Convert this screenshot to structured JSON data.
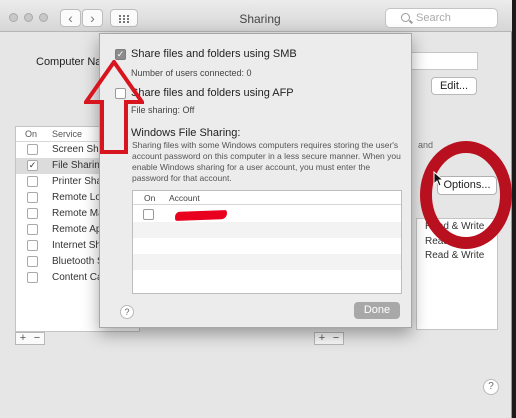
{
  "window": {
    "title": "Sharing",
    "search_placeholder": "Search",
    "back_glyph": "‹",
    "forward_glyph": "›"
  },
  "computer_name": {
    "label": "Computer Na",
    "edit_label": "Edit..."
  },
  "services": {
    "col_on": "On",
    "col_service": "Service",
    "items": [
      {
        "label": "Screen Sha",
        "checked": false
      },
      {
        "label": "File Sharing",
        "checked": true,
        "selected": true
      },
      {
        "label": "Printer Sha",
        "checked": false
      },
      {
        "label": "Remote Log",
        "checked": false
      },
      {
        "label": "Remote Ma",
        "checked": false
      },
      {
        "label": "Remote Ap",
        "checked": false
      },
      {
        "label": "Internet Sh",
        "checked": false
      },
      {
        "label": "Bluetooth S",
        "checked": false
      },
      {
        "label": "Content Ca",
        "checked": false
      }
    ],
    "add_glyph": "+",
    "remove_glyph": "−"
  },
  "right_panel": {
    "partial_text": "and",
    "options_label": "Options...",
    "permissions": [
      "Read & Write",
      "Read & Write",
      "Read & Write"
    ],
    "add_glyph": "+",
    "remove_glyph": "−"
  },
  "sheet": {
    "smb_label": "Share files and folders using SMB",
    "smb_checked": true,
    "smb_status": "Number of users connected: 0",
    "afp_label": "Share files and folders using AFP",
    "afp_checked": false,
    "afp_status": "File sharing: Off",
    "win_heading": "Windows File Sharing:",
    "win_desc": "Sharing files with some Windows computers requires storing the user's account password on this computer in a less secure manner.  When you enable Windows sharing for a user account, you must enter the password for that account.",
    "table": {
      "col_on": "On",
      "col_account": "Account"
    },
    "help_glyph": "?",
    "done_label": "Done"
  },
  "help_glyph": "?",
  "annotation_colors": {
    "arrow": "#d8151e",
    "circle": "#b8101e"
  }
}
